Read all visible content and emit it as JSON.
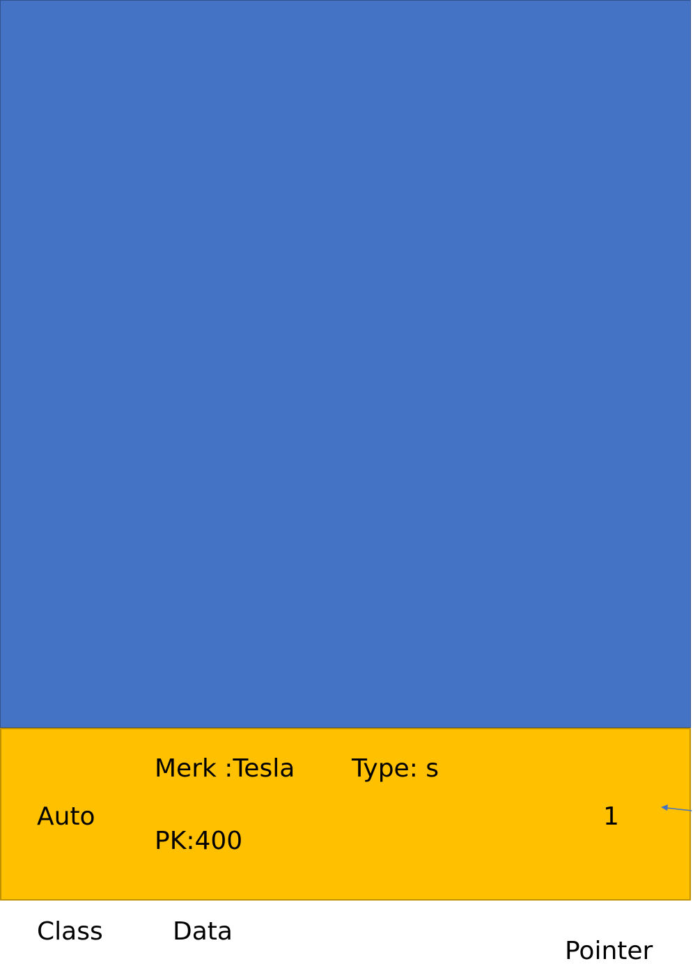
{
  "object": {
    "class_value": "Auto",
    "merk": "Merk :Tesla",
    "type": "Type: s",
    "pk": "PK:400",
    "pointer_value": "1"
  },
  "labels": {
    "class": "Class",
    "data": "Data",
    "pointer": "Pointer"
  },
  "colors": {
    "memory_block": "#4472c4",
    "object_row": "#ffc000",
    "arrow": "#4472c4"
  },
  "icons": {
    "arrow": "arrow-left-icon"
  }
}
